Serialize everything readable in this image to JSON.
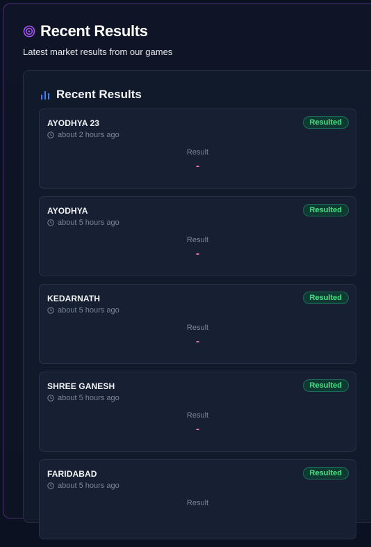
{
  "header": {
    "title": "Recent Results",
    "subtitle": "Latest market results from our games",
    "icon": "target-icon"
  },
  "panel": {
    "title": "Recent Results",
    "icon": "bar-chart-icon"
  },
  "results": [
    {
      "name": "AYODHYA 23",
      "time": "about 2 hours ago",
      "status": "Resulted",
      "result_label": "Result",
      "result_value": "-"
    },
    {
      "name": "AYODHYA",
      "time": "about 5 hours ago",
      "status": "Resulted",
      "result_label": "Result",
      "result_value": "-"
    },
    {
      "name": "KEDARNATH",
      "time": "about 5 hours ago",
      "status": "Resulted",
      "result_label": "Result",
      "result_value": "-"
    },
    {
      "name": "SHREE GANESH",
      "time": "about 5 hours ago",
      "status": "Resulted",
      "result_label": "Result",
      "result_value": "-"
    },
    {
      "name": "FARIDABAD",
      "time": "about 5 hours ago",
      "status": "Resulted",
      "result_label": "Result",
      "result_value": ""
    }
  ],
  "colors": {
    "accent_purple": "#a855f7",
    "accent_blue": "#3b82f6",
    "badge_green": "#4ade80",
    "result_pink": "#f472b6"
  }
}
